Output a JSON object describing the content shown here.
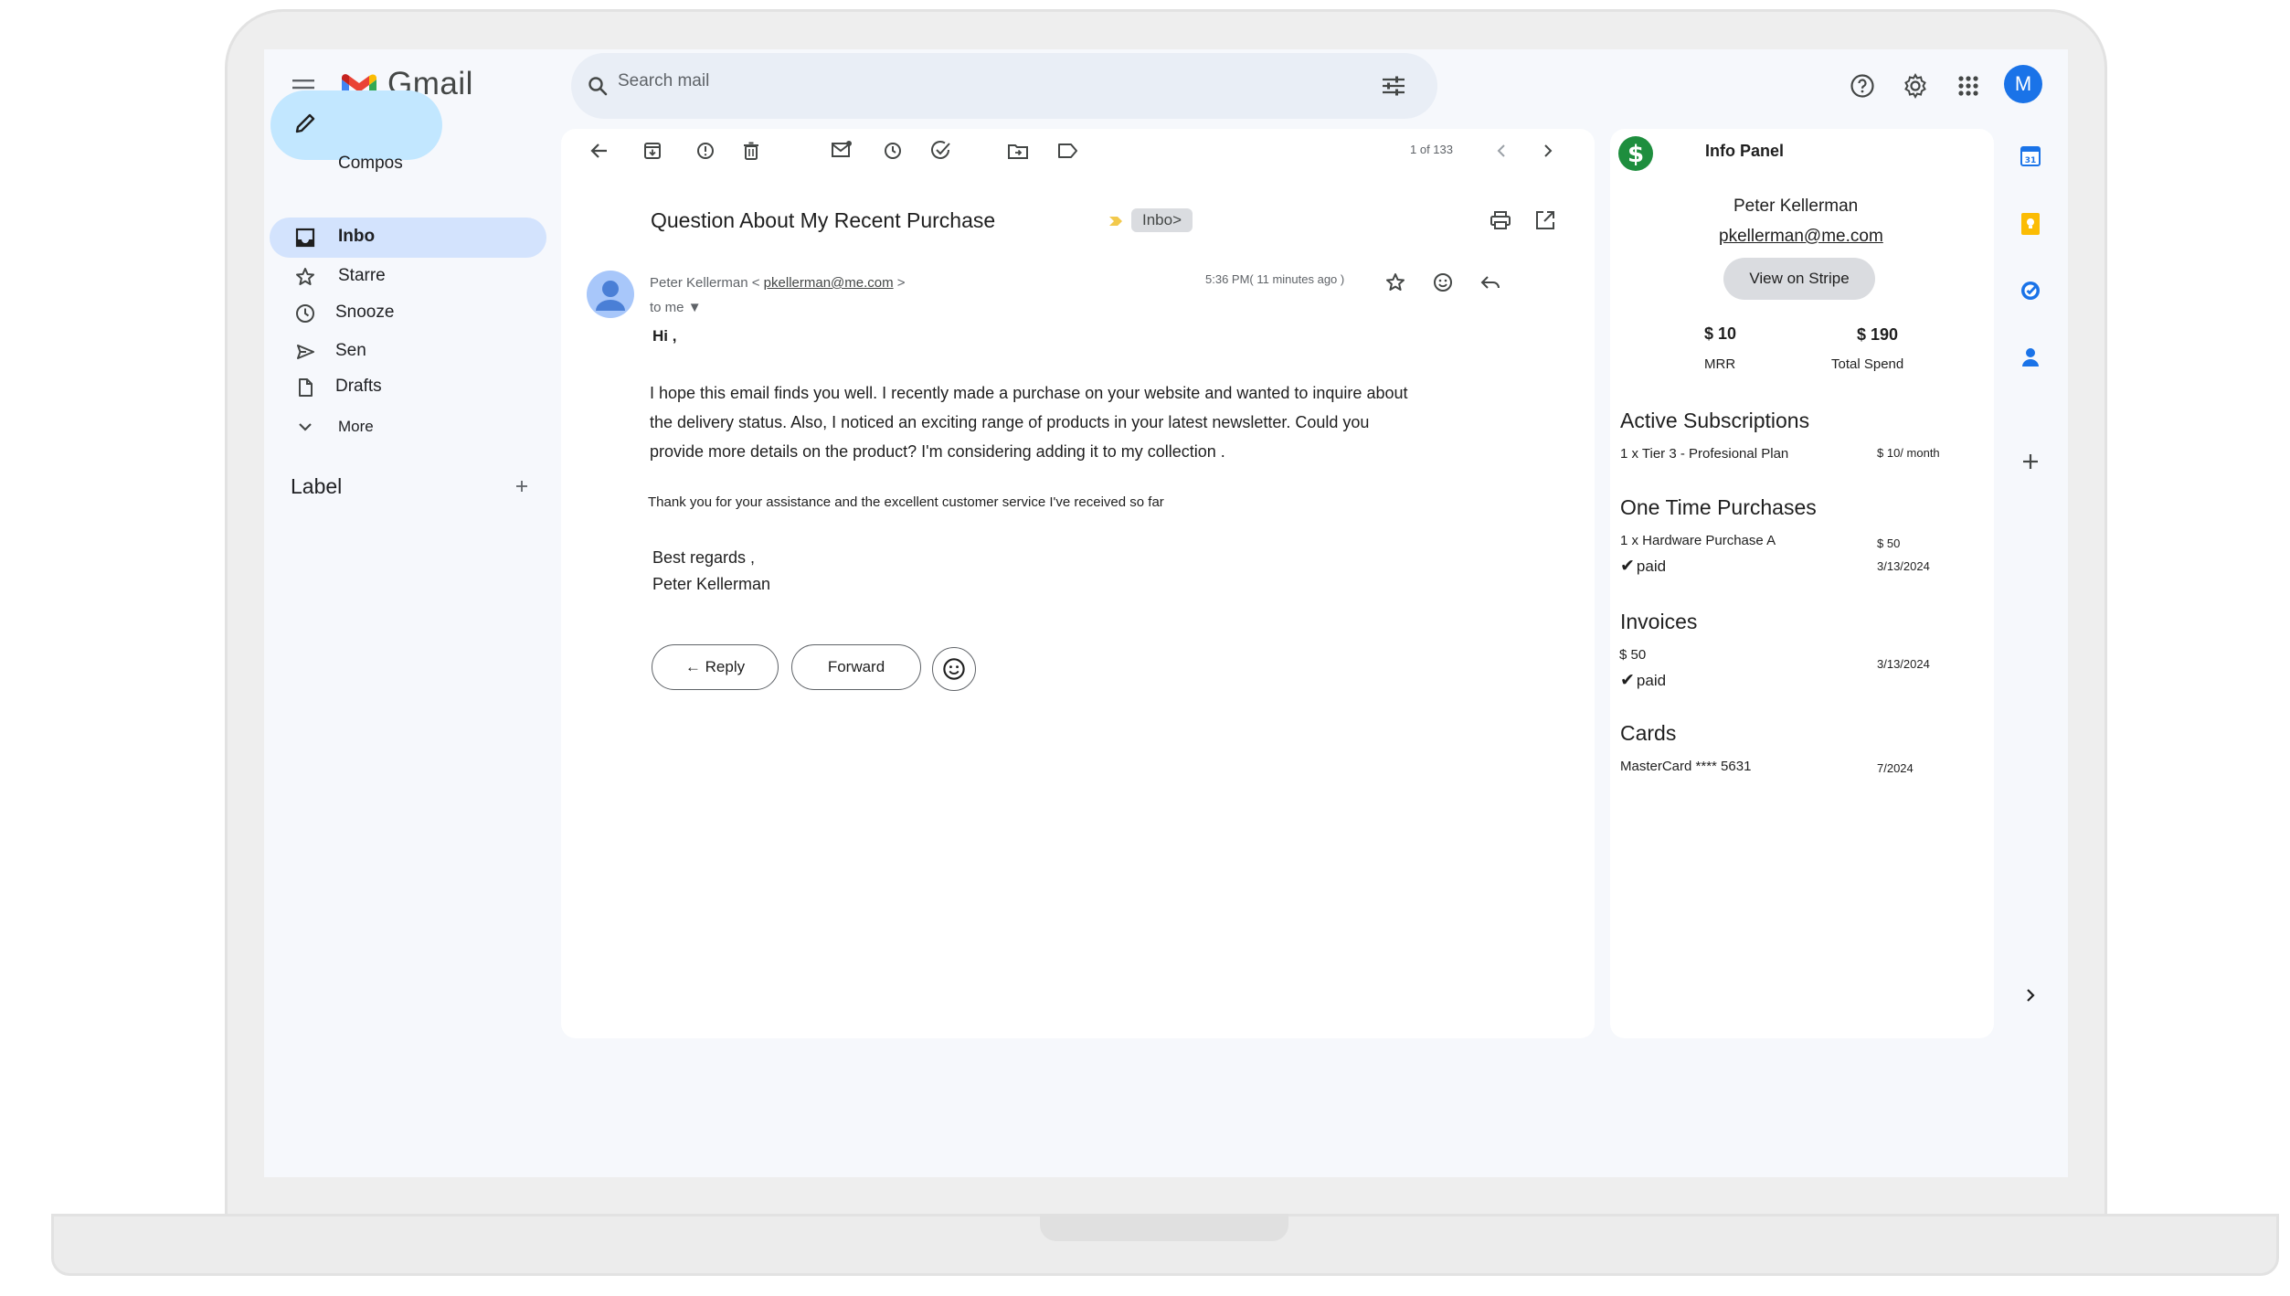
{
  "app": {
    "brand": "Gmail",
    "search_placeholder": "Search mail",
    "avatar_letter": "M"
  },
  "sidebar": {
    "compose_label": "Compos",
    "items": [
      {
        "label": "Inbo",
        "icon": "inbox-icon",
        "active": true
      },
      {
        "label": "Starre",
        "icon": "star-icon"
      },
      {
        "label": "Snooze",
        "icon": "clock-icon"
      },
      {
        "label": "Sen",
        "icon": "send-icon"
      },
      {
        "label": "Drafts",
        "icon": "draft-icon"
      },
      {
        "label": "More",
        "icon": "chevron-down-icon"
      }
    ],
    "labels_heading": "Label",
    "add_label_icon": "plus-icon"
  },
  "toolbar": {
    "pager": "1 of 133"
  },
  "email": {
    "subject": "Question About My Recent Purchase",
    "chip": "Inbo>",
    "sender_name": "Peter Kellerman",
    "sender_email": "pkellerman@me.com",
    "to": "to me",
    "time": "5:36 PM( 11 minutes ago )",
    "greeting": "Hi ,",
    "paragraph_lines": [
      "I hope this email finds you well. I recently made a purchase on your website and wanted to inquire about",
      "the delivery status. Also, I noticed an exciting range of products in your latest newsletter. Could you",
      "provide more details on the product? I'm considering adding it to my collection ."
    ],
    "thanks": "Thank you for your assistance and the excellent customer service I've received so far",
    "signoff": "Best regards ,",
    "signature": "Peter Kellerman",
    "reply_label": "← Reply",
    "forward_label": "Forward"
  },
  "info_panel": {
    "title": "Info Panel",
    "customer_name": "Peter Kellerman",
    "customer_email": "pkellerman@me.com",
    "stripe_button": "View on Stripe",
    "mrr_value": "$ 10",
    "mrr_label": "MRR",
    "spend_value": "$ 190",
    "spend_label": "Total Spend",
    "subscriptions_heading": "Active Subscriptions",
    "subscription_item": "1 x Tier 3 - Profesional Plan",
    "subscription_price": "$ 10/ month",
    "purchases_heading": "One Time Purchases",
    "purchase_item": "1 x Hardware Purchase A",
    "purchase_price": "$ 50",
    "purchase_status": "paid",
    "purchase_date": "3/13/2024",
    "invoices_heading": "Invoices",
    "invoice_amount": "$ 50",
    "invoice_status": "paid",
    "invoice_date": "3/13/2024",
    "cards_heading": "Cards",
    "card_item": "MasterCard **** 5631",
    "card_expiry": "7/2024"
  },
  "colors": {
    "compose_bg": "#c2e7ff",
    "active_nav_bg": "#d3e3fd",
    "search_bg": "#e9eef6",
    "stripe_green": "#1e8e3e",
    "accent_blue": "#1a73e8"
  }
}
